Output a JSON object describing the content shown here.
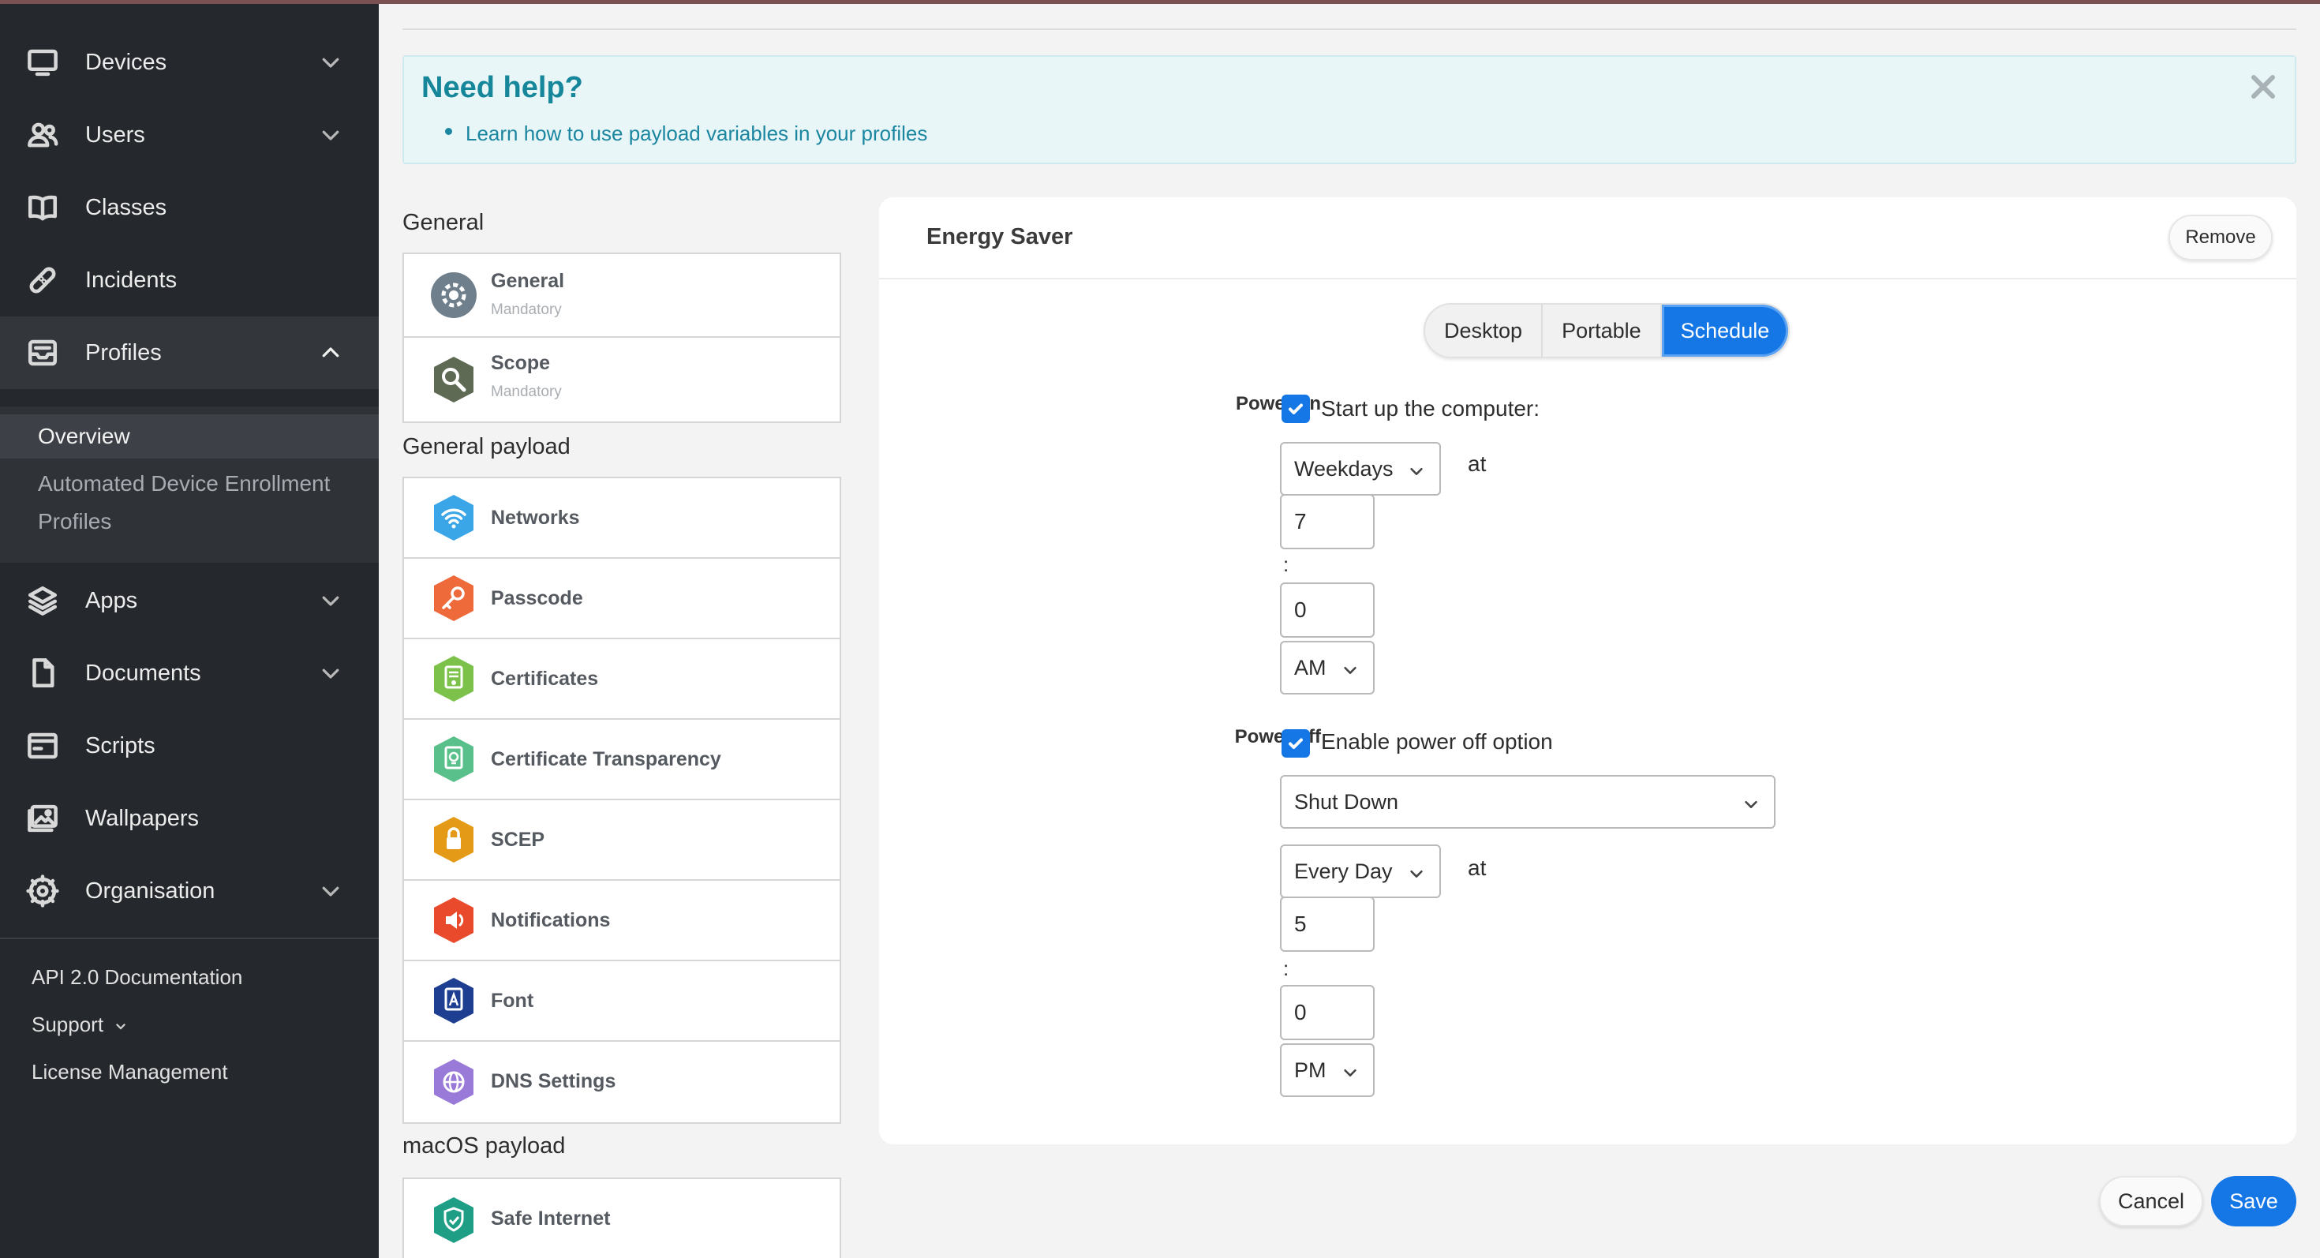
{
  "sidebar": {
    "items": [
      {
        "label": "Devices",
        "icon": "monitor-icon"
      },
      {
        "label": "Users",
        "icon": "users-icon"
      },
      {
        "label": "Classes",
        "icon": "book-icon"
      },
      {
        "label": "Incidents",
        "icon": "bandage-icon"
      },
      {
        "label": "Profiles",
        "icon": "inbox-icon"
      },
      {
        "label": "Apps",
        "icon": "layers-icon"
      },
      {
        "label": "Documents",
        "icon": "file-icon"
      },
      {
        "label": "Scripts",
        "icon": "terminal-window-icon"
      },
      {
        "label": "Wallpapers",
        "icon": "image-icon"
      },
      {
        "label": "Organisation",
        "icon": "gear-cog-icon"
      }
    ],
    "profiles_sub": {
      "overview": "Overview",
      "ade": "Automated Device Enrollment Profiles"
    },
    "footer": {
      "api": "API 2.0 Documentation",
      "support": "Support",
      "license": "License Management"
    }
  },
  "help": {
    "title": "Need help?",
    "link": "Learn how to use payload variables in your profiles"
  },
  "sections": {
    "general": "General",
    "general_payload": "General payload",
    "macos_payload": "macOS payload"
  },
  "general_items": [
    {
      "name": "General",
      "sub": "Mandatory",
      "icon": "settings-gear-icon"
    },
    {
      "name": "Scope",
      "sub": "Mandatory",
      "icon": "scope-search-icon"
    }
  ],
  "payload_items": [
    {
      "name": "Networks",
      "icon": "wifi-icon",
      "color": "#3aa6e8"
    },
    {
      "name": "Passcode",
      "icon": "key-icon",
      "color": "#ee6a3a"
    },
    {
      "name": "Certificates",
      "icon": "certificate-icon",
      "color": "#7cc24a"
    },
    {
      "name": "Certificate Transparency",
      "icon": "certificate-transparency-icon",
      "color": "#59c08b"
    },
    {
      "name": "SCEP",
      "icon": "lock-icon",
      "color": "#e59a17"
    },
    {
      "name": "Notifications",
      "icon": "notification-icon",
      "color": "#e94a2c"
    },
    {
      "name": "Font",
      "icon": "font-icon",
      "color": "#1e3f91"
    },
    {
      "name": "DNS Settings",
      "icon": "globe-icon",
      "color": "#9a7ad8"
    }
  ],
  "macos_items": [
    {
      "name": "Safe Internet",
      "icon": "shield-icon",
      "color": "#1f9e86"
    }
  ],
  "energy": {
    "title": "Energy Saver",
    "remove": "Remove",
    "tabs": [
      "Desktop",
      "Portable",
      "Schedule"
    ],
    "selected_tab": "Schedule",
    "power_on": {
      "label": "Power on",
      "checkbox": "Start up the computer:",
      "days": "Weekdays",
      "at": "at",
      "hour": "7",
      "colon": ":",
      "minute": "0",
      "ampm": "AM"
    },
    "power_off": {
      "label": "Power off",
      "checkbox": "Enable power off option",
      "action": "Shut Down",
      "days": "Every Day",
      "at": "at",
      "hour": "5",
      "colon": ":",
      "minute": "0",
      "ampm": "PM"
    }
  },
  "actions": {
    "cancel": "Cancel",
    "save": "Save"
  },
  "colors": {
    "accent": "#1577e6",
    "sidebar_bg": "#25282c",
    "help_title": "#16869a"
  }
}
